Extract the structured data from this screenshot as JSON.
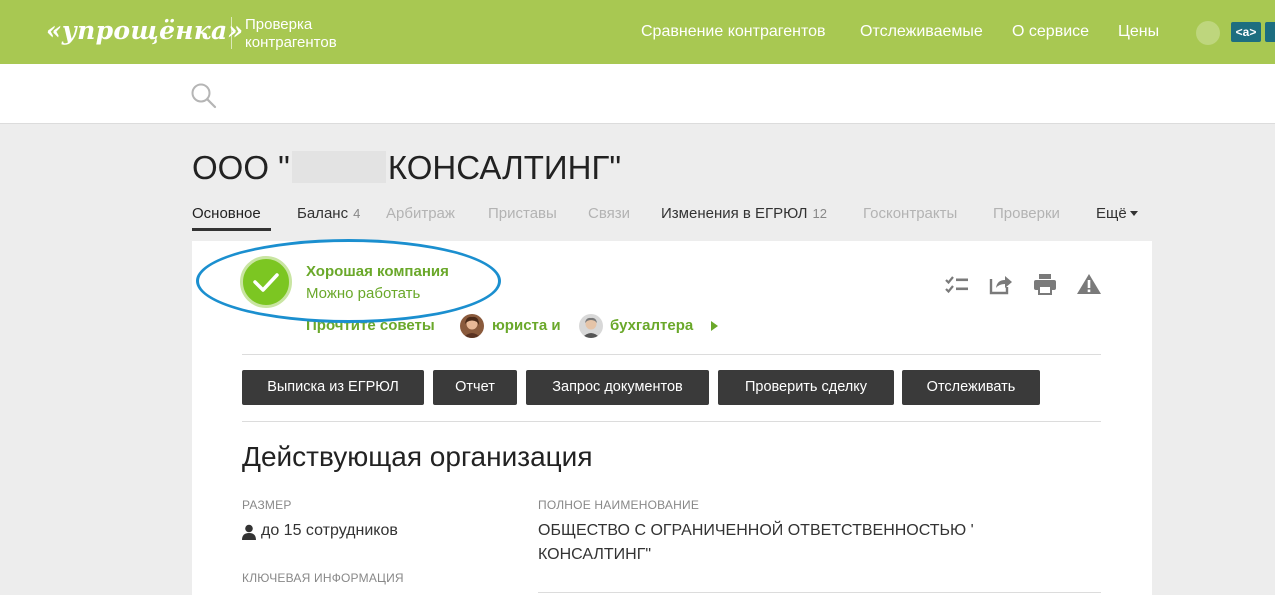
{
  "header": {
    "logo": "«упрощёнка»",
    "subtitle": "Проверка контрагентов",
    "nav": [
      "Сравнение контрагентов",
      "Отслеживаемые",
      "О сервисе",
      "Цены"
    ],
    "badge": "<a>",
    "brand_color": "#a8c852"
  },
  "search": {
    "placeholder": "",
    "icon": "search-icon"
  },
  "company": {
    "title_prefix": "ООО \"",
    "title_suffix": "КОНСАЛТИНГ\""
  },
  "tabs": [
    {
      "label": "Основное",
      "state": "active"
    },
    {
      "label": "Баланс",
      "count": "4",
      "state": "normal"
    },
    {
      "label": "Арбитраж",
      "state": "disabled"
    },
    {
      "label": "Приставы",
      "state": "disabled"
    },
    {
      "label": "Связи",
      "state": "disabled"
    },
    {
      "label": "Изменения в ЕГРЮЛ",
      "count": "12",
      "state": "normal"
    },
    {
      "label": "Госконтракты",
      "state": "disabled"
    },
    {
      "label": "Проверки",
      "state": "disabled"
    },
    {
      "label": "Ещё",
      "state": "normal"
    }
  ],
  "status": {
    "title": "Хорошая компания",
    "subtitle": "Можно работать",
    "color": "#6aa82a",
    "highlight_color": "#1b8fcf"
  },
  "advice": {
    "prefix": "Прочтите советы",
    "lawyer": "юриста и",
    "accountant": "бухгалтера"
  },
  "actions": [
    "checklist-icon",
    "share-icon",
    "print-icon",
    "warning-icon"
  ],
  "buttons": [
    "Выписка из ЕГРЮЛ",
    "Отчет",
    "Запрос документов",
    "Проверить сделку",
    "Отслеживать"
  ],
  "section": {
    "title": "Действующая организация",
    "size_label": "Размер",
    "size_value": "до 15 сотрудников",
    "key_info_label": "Ключевая информация",
    "full_name_label": "Полное наименование",
    "full_name_value": "ОБЩЕСТВО С ОГРАНИЧЕННОЙ ОТВЕТСТВЕННОСТЬЮ ' КОНСАЛТИНГ\""
  }
}
